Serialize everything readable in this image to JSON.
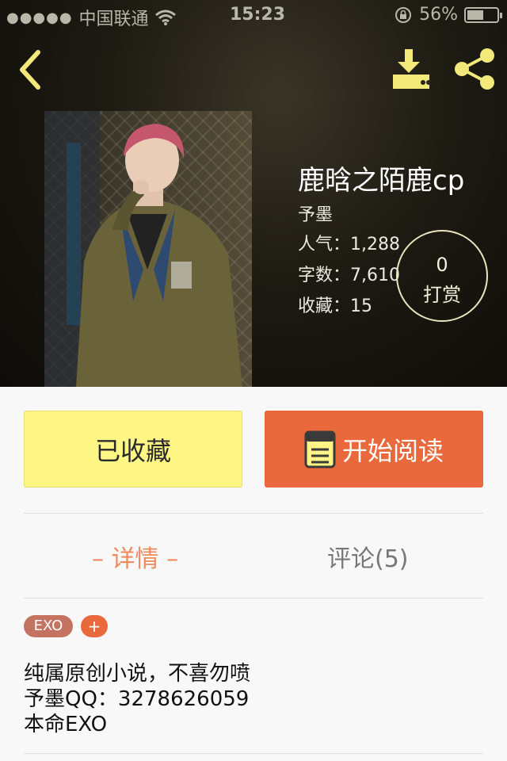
{
  "status_bar": {
    "signal": "●●●●●",
    "carrier": "中国联通",
    "time": "15:23",
    "battery_percent": "56%",
    "battery_level": 0.56
  },
  "header": {
    "back_icon": "chevron-left-icon",
    "download_icon": "download-icon",
    "share_icon": "share-icon",
    "icon_color": "#f3e87a"
  },
  "book": {
    "title": "鹿晗之陌鹿cp",
    "author": "予墨",
    "popularity": "人气：1,288",
    "word_count": "字数：7,610",
    "favorites": "收藏：15"
  },
  "tip": {
    "count": "0",
    "label": "打赏"
  },
  "actions": {
    "favorite_label": "已收藏",
    "read_label": "开始阅读",
    "favorite_color": "#fdf685",
    "read_color": "#e9683c"
  },
  "tabs": {
    "detail": "– 详情 –",
    "comments": "评论(5)",
    "active_color": "#ef8a5f"
  },
  "tags": {
    "items": [
      "EXO"
    ],
    "add": "+"
  },
  "description": {
    "lines": [
      "纯属原创小说，不喜勿喷",
      "予墨QQ：3278626059",
      "本命EXO"
    ]
  }
}
